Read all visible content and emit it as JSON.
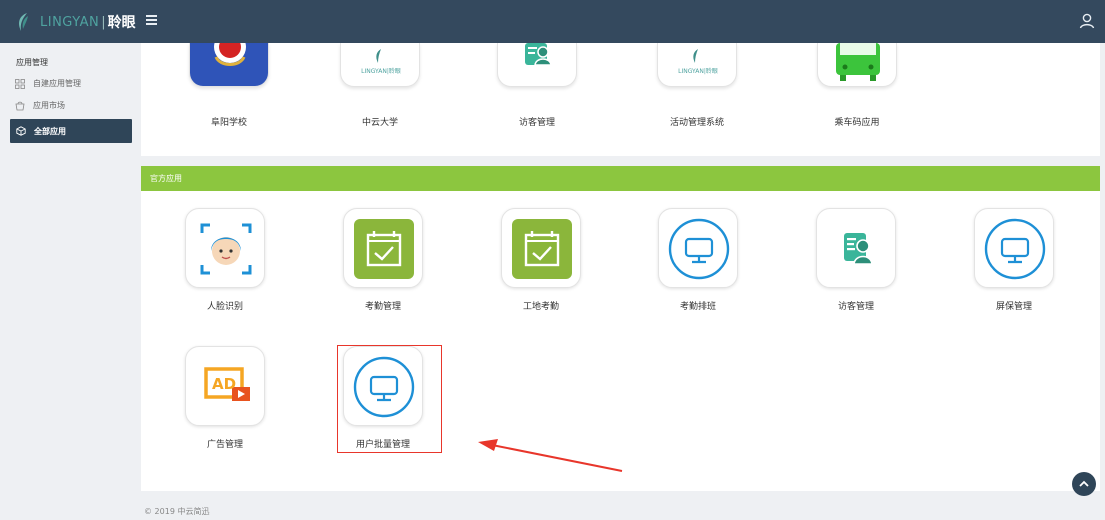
{
  "topbar": {
    "brand_en": "LINGYAN",
    "brand_sep": "|",
    "brand_cn": "聆眼",
    "menu_icon": "menu-icon",
    "user_icon": "user-icon"
  },
  "sidebar": {
    "heading": "应用管理",
    "items": [
      {
        "label": "自建应用管理",
        "icon": "grid-icon"
      },
      {
        "label": "应用市场",
        "icon": "store-icon"
      },
      {
        "label": "全部应用",
        "icon": "box-icon"
      }
    ]
  },
  "top_apps": [
    {
      "name": "阜阳学校",
      "icon": "emblem-icon"
    },
    {
      "name": "中云大学",
      "icon": "lingyan-logo-icon",
      "logo_text": "LINGYAN|聆眼"
    },
    {
      "name": "访客管理",
      "icon": "visitor-icon"
    },
    {
      "name": "活动管理系统",
      "icon": "lingyan-logo-icon",
      "logo_text": "LINGYAN|聆眼"
    },
    {
      "name": "乘车码应用",
      "icon": "bus-icon"
    }
  ],
  "official": {
    "title": "官方应用",
    "apps": [
      {
        "name": "人脸识别",
        "icon": "face-scan-icon"
      },
      {
        "name": "考勤管理",
        "icon": "calendar-check-icon"
      },
      {
        "name": "工地考勤",
        "icon": "calendar-check-icon"
      },
      {
        "name": "考勤排班",
        "icon": "monitor-icon"
      },
      {
        "name": "访客管理",
        "icon": "visitor-icon"
      },
      {
        "name": "屏保管理",
        "icon": "monitor-icon"
      },
      {
        "name": "广告管理",
        "icon": "ad-icon",
        "badge_text": "AD"
      },
      {
        "name": "用户批量管理",
        "icon": "monitor-icon"
      }
    ]
  },
  "footer": {
    "text": "© 2019 中云简迅"
  },
  "colors": {
    "topbar": "#34495e",
    "accent_green": "#8cc63f",
    "highlight_red": "#e8362b",
    "icon_blue": "#1e90d6"
  }
}
